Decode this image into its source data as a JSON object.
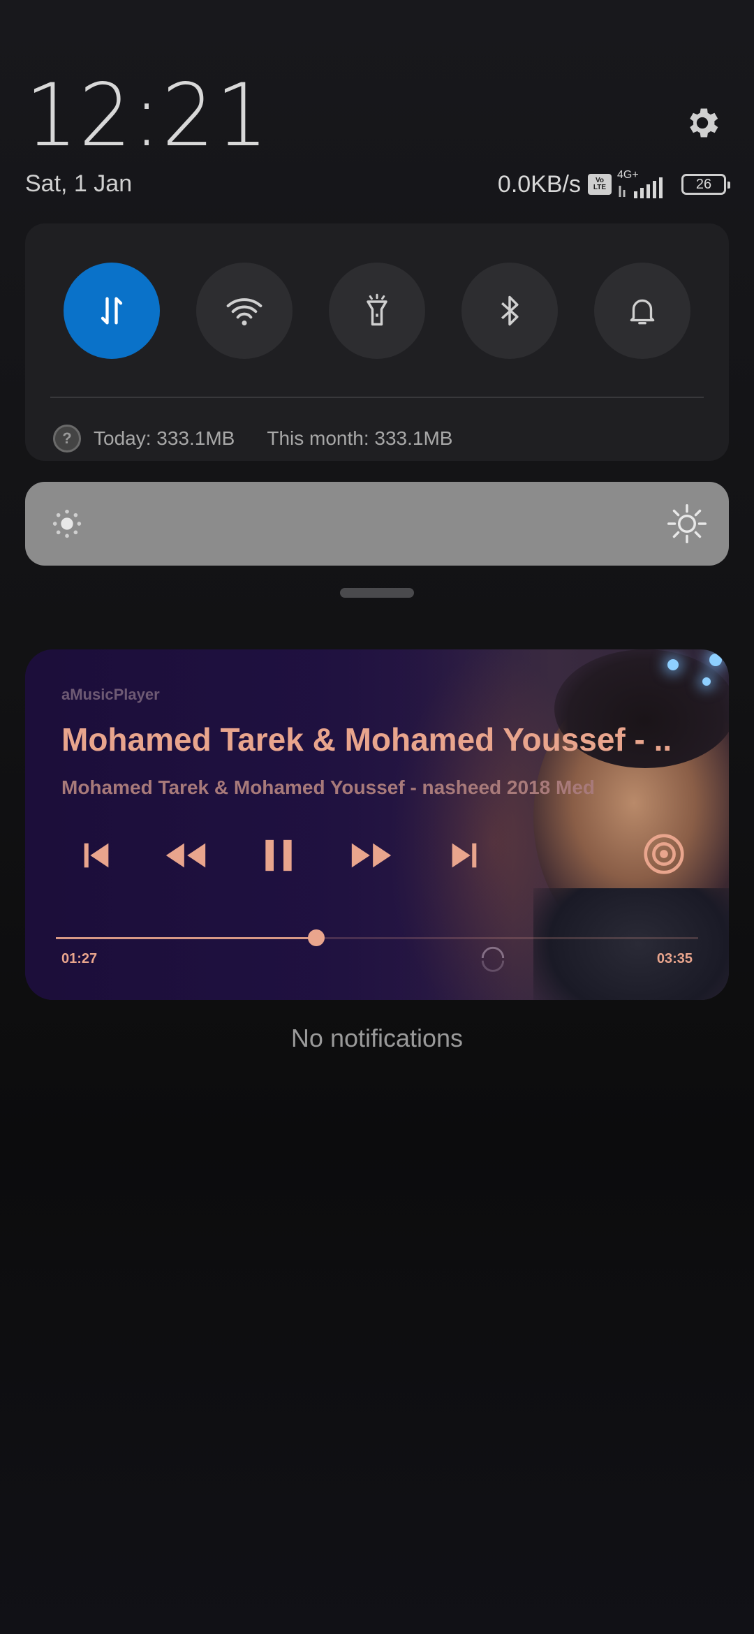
{
  "header": {
    "time": "12:21",
    "date": "Sat, 1 Jan",
    "network_speed": "0.0KB/s",
    "volte_top": "Vo",
    "volte_bottom": "LTE",
    "network_type": "4G+",
    "battery_level": "26",
    "icons": [
      "settings-gear-icon",
      "volte-icon",
      "signal-icon",
      "battery-icon"
    ]
  },
  "quick_settings": {
    "toggles": [
      {
        "name": "mobile-data",
        "icon": "data-transfer-icon",
        "active": true
      },
      {
        "name": "wifi",
        "icon": "wifi-icon",
        "active": false
      },
      {
        "name": "flashlight",
        "icon": "flashlight-icon",
        "active": false
      },
      {
        "name": "bluetooth",
        "icon": "bluetooth-icon",
        "active": false
      },
      {
        "name": "notifications",
        "icon": "bell-icon",
        "active": false
      }
    ],
    "usage_today": "Today: 333.1MB",
    "usage_month": "This month: 333.1MB",
    "active_color": "#0a72c9"
  },
  "brightness": {
    "level": 0.0,
    "low_icon": "brightness-low-icon",
    "high_icon": "brightness-high-icon"
  },
  "media": {
    "app_name": "aMusicPlayer",
    "title": "Mohamed Tarek & Mohamed Youssef - ..",
    "artist": "Mohamed Tarek & Mohamed Youssef - nasheed 2018 Med",
    "current_time": "01:27",
    "total_time": "03:35",
    "progress": 0.405,
    "accent_color": "#e9a58d",
    "controls": [
      "skip-previous-icon",
      "rewind-icon",
      "pause-icon",
      "fast-forward-icon",
      "skip-next-icon",
      "cast-icon"
    ]
  },
  "empty_state": "No notifications"
}
